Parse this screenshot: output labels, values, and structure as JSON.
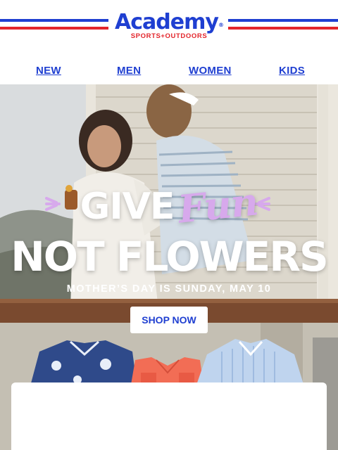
{
  "brand": {
    "name": "Academy",
    "tagline": "SPORTS+OUTDOORS",
    "trademark": "®",
    "colors": {
      "blue": "#1f3fd1",
      "red": "#e3252b"
    }
  },
  "nav": {
    "items": [
      {
        "label": "NEW"
      },
      {
        "label": "MEN"
      },
      {
        "label": "WOMEN"
      },
      {
        "label": "KIDS"
      }
    ]
  },
  "hero": {
    "headline_give": "GIVE",
    "headline_fun": "Fun",
    "headline_line2": "NOT FLOWERS",
    "subline": "MOTHER’S DAY IS SUNDAY, MAY 10",
    "cta_label": "SHOP NOW",
    "accent_color": "#d7a9ec",
    "products": [
      {
        "icon": "blue-floral-fishing-shirt"
      },
      {
        "icon": "coral-sleeveless-fishing-shirt"
      },
      {
        "icon": "light-blue-striped-shirt"
      }
    ]
  }
}
